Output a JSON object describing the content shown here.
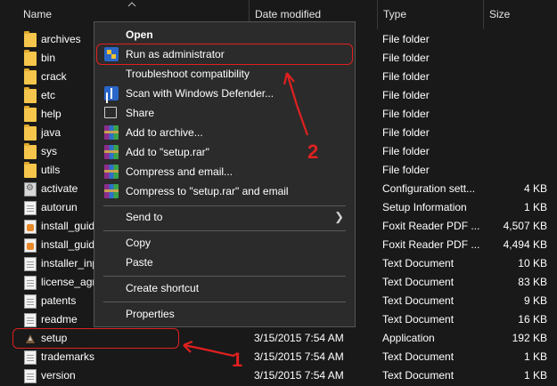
{
  "header": {
    "name": "Name",
    "date_modified": "Date modified",
    "type": "Type",
    "size": "Size"
  },
  "files": [
    {
      "name": "archives",
      "date": "",
      "type": "File folder",
      "size": "",
      "icon": "folder-icon"
    },
    {
      "name": "bin",
      "date": "",
      "type": "File folder",
      "size": "",
      "icon": "folder-icon"
    },
    {
      "name": "crack",
      "date": "",
      "type": "File folder",
      "size": "",
      "icon": "folder-icon"
    },
    {
      "name": "etc",
      "date": "",
      "type": "File folder",
      "size": "",
      "icon": "folder-icon"
    },
    {
      "name": "help",
      "date": "",
      "type": "File folder",
      "size": "",
      "icon": "folder-icon"
    },
    {
      "name": "java",
      "date": "",
      "type": "File folder",
      "size": "",
      "icon": "folder-icon"
    },
    {
      "name": "sys",
      "date": "",
      "type": "File folder",
      "size": "",
      "icon": "folder-icon"
    },
    {
      "name": "utils",
      "date": "",
      "type": "File folder",
      "size": "",
      "icon": "folder-icon"
    },
    {
      "name": "activate",
      "date": "",
      "type": "Configuration sett...",
      "size": "4 KB",
      "icon": "config-file-icon"
    },
    {
      "name": "autorun",
      "date": "",
      "type": "Setup Information",
      "size": "1 KB",
      "icon": "document-icon"
    },
    {
      "name": "install_guid",
      "date": "",
      "type": "Foxit Reader PDF ...",
      "size": "4,507 KB",
      "icon": "pdf-icon"
    },
    {
      "name": "install_guid",
      "date": "",
      "type": "Foxit Reader PDF ...",
      "size": "4,494 KB",
      "icon": "pdf-icon"
    },
    {
      "name": "installer_inp",
      "date": "",
      "type": "Text Document",
      "size": "10 KB",
      "icon": "document-icon"
    },
    {
      "name": "license_agre",
      "date": "",
      "type": "Text Document",
      "size": "83 KB",
      "icon": "document-icon"
    },
    {
      "name": "patents",
      "date": "",
      "type": "Text Document",
      "size": "9 KB",
      "icon": "document-icon"
    },
    {
      "name": "readme",
      "date": "",
      "type": "Text Document",
      "size": "16 KB",
      "icon": "document-icon"
    },
    {
      "name": "setup",
      "date": "3/15/2015 7:54 AM",
      "type": "Application",
      "size": "192 KB",
      "icon": "application-icon"
    },
    {
      "name": "trademarks",
      "date": "3/15/2015 7:54 AM",
      "type": "Text Document",
      "size": "1 KB",
      "icon": "document-icon"
    },
    {
      "name": "version",
      "date": "3/15/2015 7:54 AM",
      "type": "Text Document",
      "size": "1 KB",
      "icon": "document-icon"
    }
  ],
  "context_menu": {
    "open": "Open",
    "run_as_admin": "Run as administrator",
    "troubleshoot": "Troubleshoot compatibility",
    "scan_defender": "Scan with Windows Defender...",
    "share": "Share",
    "add_archive": "Add to archive...",
    "add_setup_rar": "Add to \"setup.rar\"",
    "compress_email": "Compress and email...",
    "compress_setup_email": "Compress to \"setup.rar\" and email",
    "send_to": "Send to",
    "copy": "Copy",
    "paste": "Paste",
    "create_shortcut": "Create shortcut",
    "properties": "Properties"
  },
  "annotations": {
    "step1": "1",
    "step2": "2"
  },
  "colors": {
    "background": "#191919",
    "menu_bg": "#2b2b2b",
    "annotation": "#e02020",
    "folder": "#f5c64b"
  }
}
